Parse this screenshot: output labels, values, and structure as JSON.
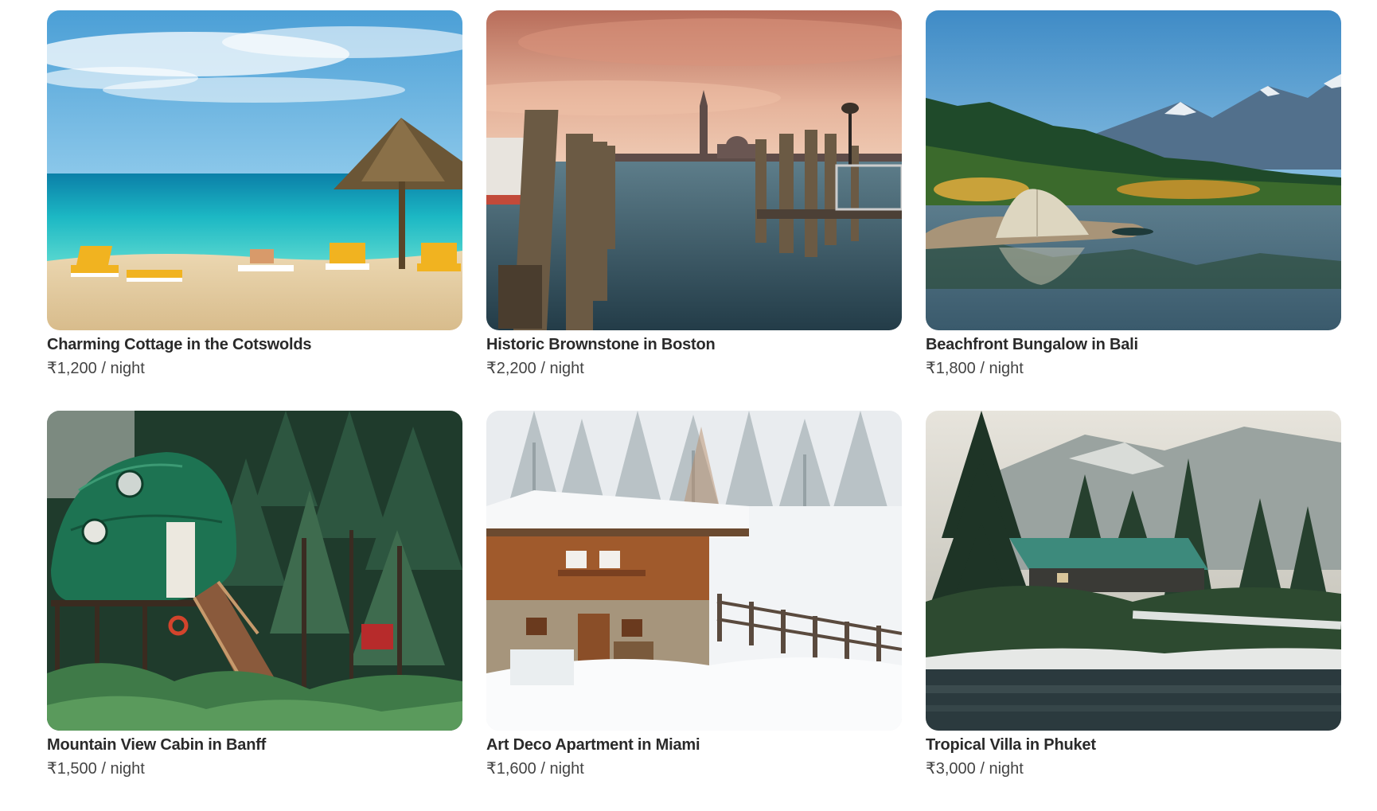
{
  "listings": [
    {
      "title": "Charming Cottage in the Cotswolds",
      "price": "₹1,200 / night",
      "image": "beach-with-umbrella-and-loungers"
    },
    {
      "title": "Historic Brownstone in Boston",
      "price": "₹2,200 / night",
      "image": "venice-lagoon-with-wooden-poles"
    },
    {
      "title": "Beachfront Bungalow in Bali",
      "price": "₹1,800 / night",
      "image": "tent-by-mountain-lake"
    },
    {
      "title": "Mountain View Cabin in Banff",
      "price": "₹1,500 / night",
      "image": "dome-treehouse-in-forest"
    },
    {
      "title": "Art Deco Apartment in Miami",
      "price": "₹1,600 / night",
      "image": "snowy-wooden-chalet"
    },
    {
      "title": "Tropical Villa in Phuket",
      "price": "₹3,000 / night",
      "image": "lakeside-cabin-among-pines"
    }
  ]
}
